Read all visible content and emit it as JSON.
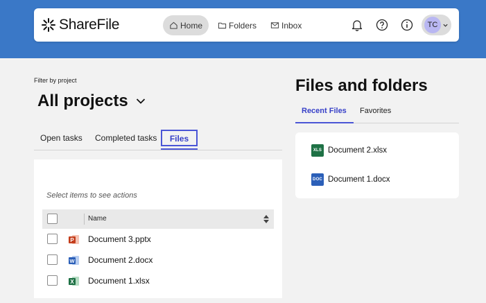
{
  "app": {
    "name": "ShareFile"
  },
  "nav": {
    "home": "Home",
    "folders": "Folders",
    "inbox": "Inbox"
  },
  "user": {
    "initials": "TC"
  },
  "project_filter": {
    "label": "Filter by project",
    "value": "All projects"
  },
  "tabs": [
    {
      "label": "Open tasks"
    },
    {
      "label": "Completed tasks"
    },
    {
      "label": "Files",
      "selected": true
    }
  ],
  "files_panel": {
    "hint": "Select items to see actions",
    "column_name": "Name",
    "rows": [
      {
        "name": "Document 3.pptx",
        "type": "pptx"
      },
      {
        "name": "Document 2.docx",
        "type": "docx"
      },
      {
        "name": "Document 1.xlsx",
        "type": "xlsx"
      }
    ]
  },
  "files_and_folders": {
    "title": "Files and folders",
    "tabs": [
      {
        "label": "Recent Files",
        "selected": true
      },
      {
        "label": "Favorites"
      }
    ],
    "recent": [
      {
        "badge": "XLS",
        "name": "Document 2.xlsx",
        "color": "#1e7145"
      },
      {
        "badge": "DOC",
        "name": "Document 1.docx",
        "color": "#2b5fb8"
      }
    ]
  },
  "colors": {
    "header_band": "#3a78c7",
    "accent": "#4a55d6",
    "avatar": "#b9b7f2"
  }
}
